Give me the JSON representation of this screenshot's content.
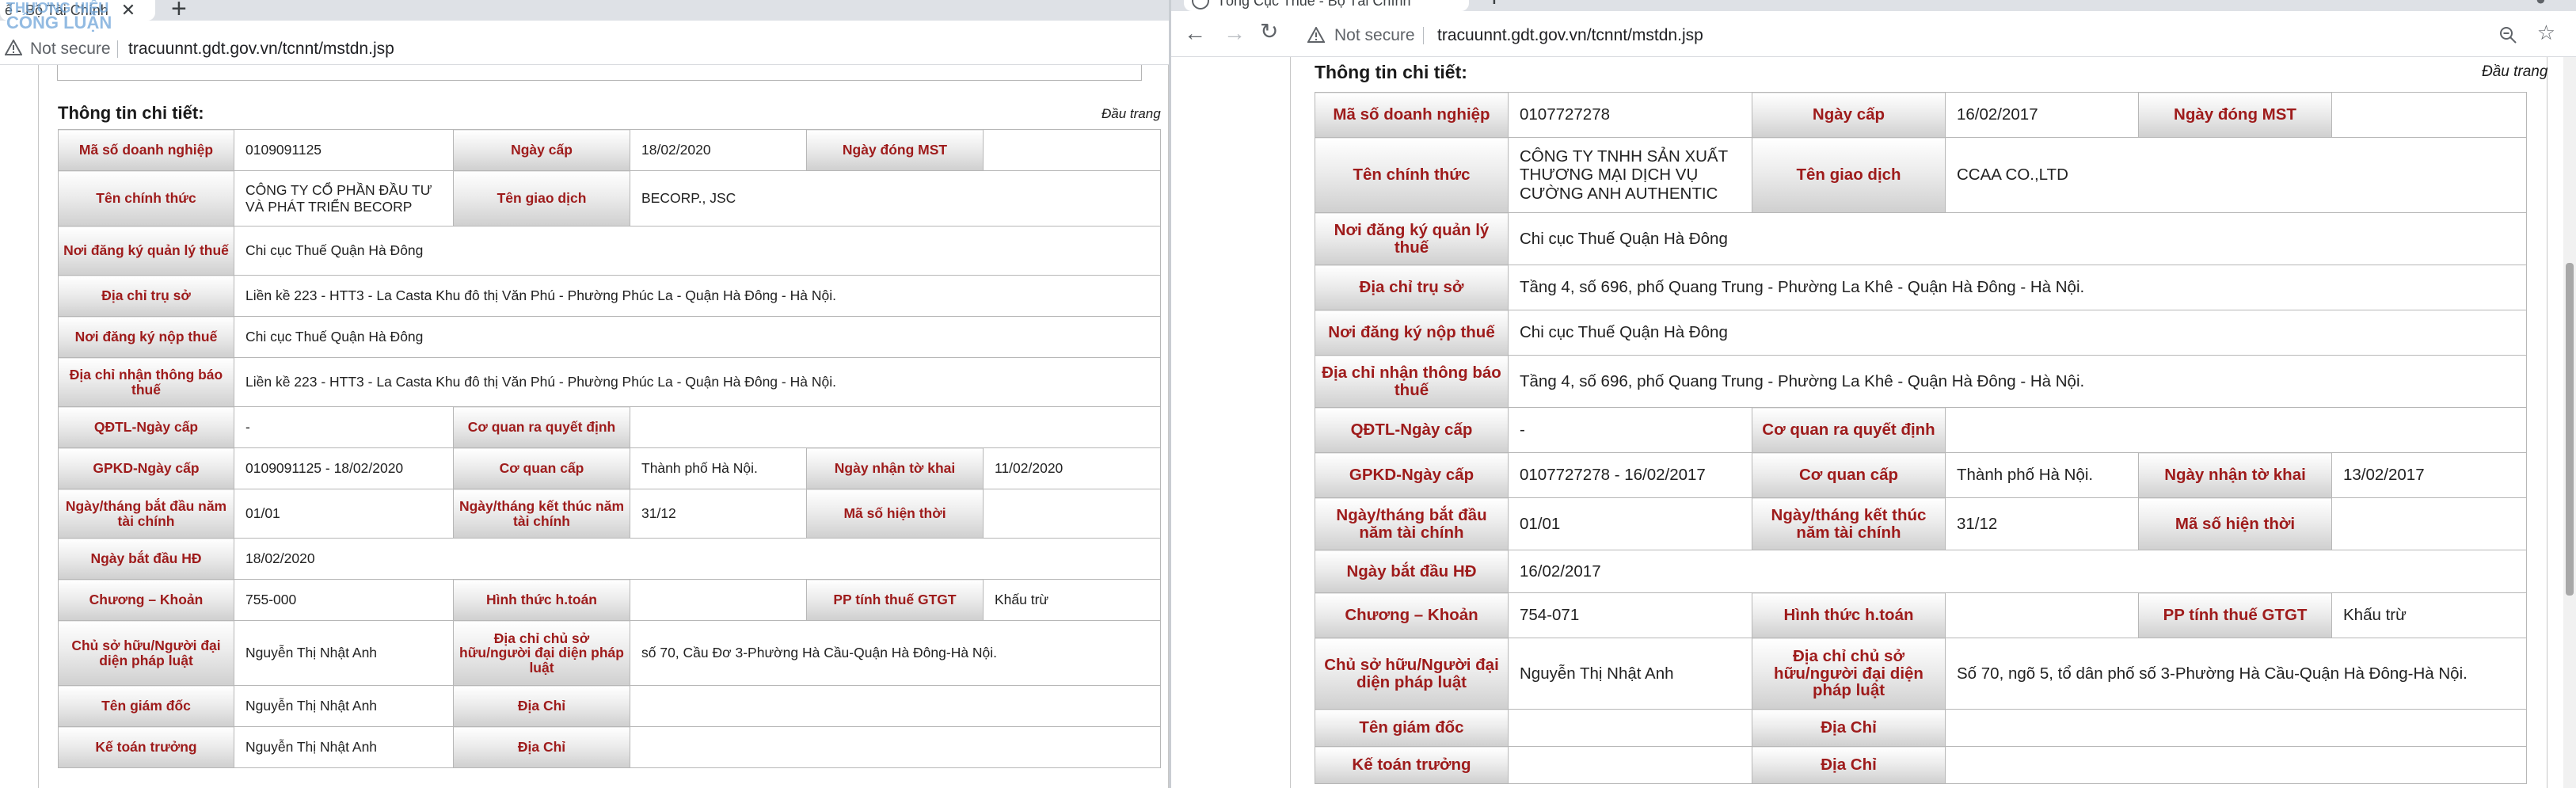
{
  "left": {
    "tab_title": "ế - Bộ Tài Chính",
    "url": "tracuunnt.gdt.gov.vn/tcnnt/mstdn.jsp",
    "not_secure": "Not secure",
    "watermark_line1": "THƯƠNG HIỆU",
    "watermark_line2": "CÔNG LUẬN",
    "section_title": "Thông tin chi tiết:",
    "top_link": "Đầu trang",
    "fields": {
      "ma_so_dn": "Mã số doanh nghiệp",
      "ma_so_dn_val": "0109091125",
      "ngay_cap": "Ngày cấp",
      "ngay_cap_val": "18/02/2020",
      "ngay_dong": "Ngày đóng MST",
      "ngay_dong_val": "",
      "ten_chinh_thuc": "Tên chính thức",
      "ten_chinh_thuc_val": "CÔNG TY CỔ PHẦN ĐẦU TƯ VÀ PHÁT TRIỂN BECORP",
      "ten_giao_dich": "Tên giao dịch",
      "ten_giao_dich_val": "BECORP., JSC",
      "noi_dk_quan_ly": "Nơi đăng ký quản lý thuế",
      "noi_dk_quan_ly_val": "Chi cục Thuế Quận Hà Đông",
      "dia_chi_tru_so": "Địa chỉ trụ sở",
      "dia_chi_tru_so_val": "Liền kề 223 - HTT3 - La Casta Khu đô thị Văn Phú - Phường Phúc La - Quận Hà Đông - Hà Nội.",
      "noi_dk_nop": "Nơi đăng ký nộp thuế",
      "noi_dk_nop_val": "Chi cục Thuế Quận Hà Đông",
      "dia_chi_tb": "Địa chỉ nhận thông báo thuế",
      "dia_chi_tb_val": "Liền kề 223 - HTT3 - La Casta Khu đô thị Văn Phú - Phường Phúc La - Quận Hà Đông - Hà Nội.",
      "qdtl": "QĐTL-Ngày cấp",
      "qdtl_val": "-",
      "co_quan_qd": "Cơ quan ra quyết định",
      "co_quan_qd_val": "",
      "gpkd": "GPKD-Ngày cấp",
      "gpkd_val": "0109091125 - 18/02/2020",
      "co_quan_cap": "Cơ quan cấp",
      "co_quan_cap_val": "Thành phố Hà Nội.",
      "ngay_nhan_tk": "Ngày nhận tờ khai",
      "ngay_nhan_tk_val": "11/02/2020",
      "ngay_bd_nam_tc": "Ngày/tháng bắt đầu năm tài chính",
      "ngay_bd_nam_tc_val": "01/01",
      "ngay_kt_nam_tc": "Ngày/tháng kết thúc năm tài chính",
      "ngay_kt_nam_tc_val": "31/12",
      "ma_so_ht": "Mã số hiện thời",
      "ma_so_ht_val": "",
      "ngay_bd_hd": "Ngày bắt đầu HĐ",
      "ngay_bd_hd_val": "18/02/2020",
      "chuong_khoan": "Chương – Khoản",
      "chuong_khoan_val": "755-000",
      "hinh_thuc": "Hình thức h.toán",
      "hinh_thuc_val": "",
      "pp_tinh_thue": "PP tính thuế GTGT",
      "pp_tinh_thue_val": "Khấu trừ",
      "chu_so_huu": "Chủ sở hữu/Người đại diện pháp luật",
      "chu_so_huu_val": "Nguyễn Thị Nhật Anh",
      "dia_chi_csh": "Địa chỉ chủ sở hữu/người đại diện pháp luật",
      "dia_chi_csh_val": "số 70, Cầu Đơ 3-Phường Hà Cầu-Quận Hà Đông-Hà Nội.",
      "ten_giam_doc": "Tên giám đốc",
      "ten_giam_doc_val": "Nguyễn Thị Nhật Anh",
      "dia_chi_gd": "Địa Chỉ",
      "dia_chi_gd_val": "",
      "ke_toan": "Kế toán trưởng",
      "ke_toan_val": "Nguyễn Thị Nhật Anh",
      "dia_chi_kt": "Địa Chỉ",
      "dia_chi_kt_val": ""
    }
  },
  "right": {
    "tab_title": "Tổng Cục Thuế - Bộ Tài Chính",
    "url": "tracuunnt.gdt.gov.vn/tcnnt/mstdn.jsp",
    "not_secure": "Not secure",
    "section_title": "Thông tin chi tiết:",
    "top_link": "Đầu trang",
    "fields": {
      "ma_so_dn": "Mã số doanh nghiệp",
      "ma_so_dn_val": "0107727278",
      "ngay_cap": "Ngày cấp",
      "ngay_cap_val": "16/02/2017",
      "ngay_dong": "Ngày đóng MST",
      "ngay_dong_val": "",
      "ten_chinh_thuc": "Tên chính thức",
      "ten_chinh_thuc_val": "CÔNG TY TNHH SẢN XUẤT THƯƠNG MẠI DỊCH VỤ CƯỜNG ANH AUTHENTIC",
      "ten_giao_dich": "Tên giao dịch",
      "ten_giao_dich_val": "CCAA CO.,LTD",
      "noi_dk_quan_ly": "Nơi đăng ký quản lý thuế",
      "noi_dk_quan_ly_val": "Chi cục Thuế Quận Hà Đông",
      "dia_chi_tru_so": "Địa chỉ trụ sở",
      "dia_chi_tru_so_val": "Tầng 4, số 696, phố Quang Trung - Phường La Khê - Quận Hà Đông - Hà Nội.",
      "noi_dk_nop": "Nơi đăng ký nộp thuế",
      "noi_dk_nop_val": "Chi cục Thuế Quận Hà Đông",
      "dia_chi_tb": "Địa chỉ nhận thông báo thuế",
      "dia_chi_tb_val": "Tầng 4, số 696, phố Quang Trung - Phường La Khê - Quận Hà Đông - Hà Nội.",
      "qdtl": "QĐTL-Ngày cấp",
      "qdtl_val": "-",
      "co_quan_qd": "Cơ quan ra quyết định",
      "co_quan_qd_val": "",
      "gpkd": "GPKD-Ngày cấp",
      "gpkd_val": "0107727278 - 16/02/2017",
      "co_quan_cap": "Cơ quan cấp",
      "co_quan_cap_val": "Thành phố Hà Nội.",
      "ngay_nhan_tk": "Ngày nhận tờ khai",
      "ngay_nhan_tk_val": "13/02/2017",
      "ngay_bd_nam_tc": "Ngày/tháng bắt đầu năm tài chính",
      "ngay_bd_nam_tc_val": "01/01",
      "ngay_kt_nam_tc": "Ngày/tháng kết thúc năm tài chính",
      "ngay_kt_nam_tc_val": "31/12",
      "ma_so_ht": "Mã số hiện thời",
      "ma_so_ht_val": "",
      "ngay_bd_hd": "Ngày bắt đầu HĐ",
      "ngay_bd_hd_val": "16/02/2017",
      "chuong_khoan": "Chương – Khoản",
      "chuong_khoan_val": "754-071",
      "hinh_thuc": "Hình thức h.toán",
      "hinh_thuc_val": "",
      "pp_tinh_thue": "PP tính thuế GTGT",
      "pp_tinh_thue_val": "Khấu trừ",
      "chu_so_huu": "Chủ sở hữu/Người đại diện pháp luật",
      "chu_so_huu_val": "Nguyễn Thị Nhật Anh",
      "dia_chi_csh": "Địa chỉ chủ sở hữu/người đại diện pháp luật",
      "dia_chi_csh_val": "Số 70, ngõ 5, tổ dân phố số 3-Phường Hà Cầu-Quận Hà Đông-Hà Nội.",
      "ten_giam_doc": "Tên giám đốc",
      "ten_giam_doc_val": "",
      "dia_chi_gd": "Địa Chỉ",
      "dia_chi_gd_val": "",
      "ke_toan": "Kế toán trưởng",
      "ke_toan_val": "",
      "dia_chi_kt": "Địa Chỉ",
      "dia_chi_kt_val": ""
    }
  }
}
